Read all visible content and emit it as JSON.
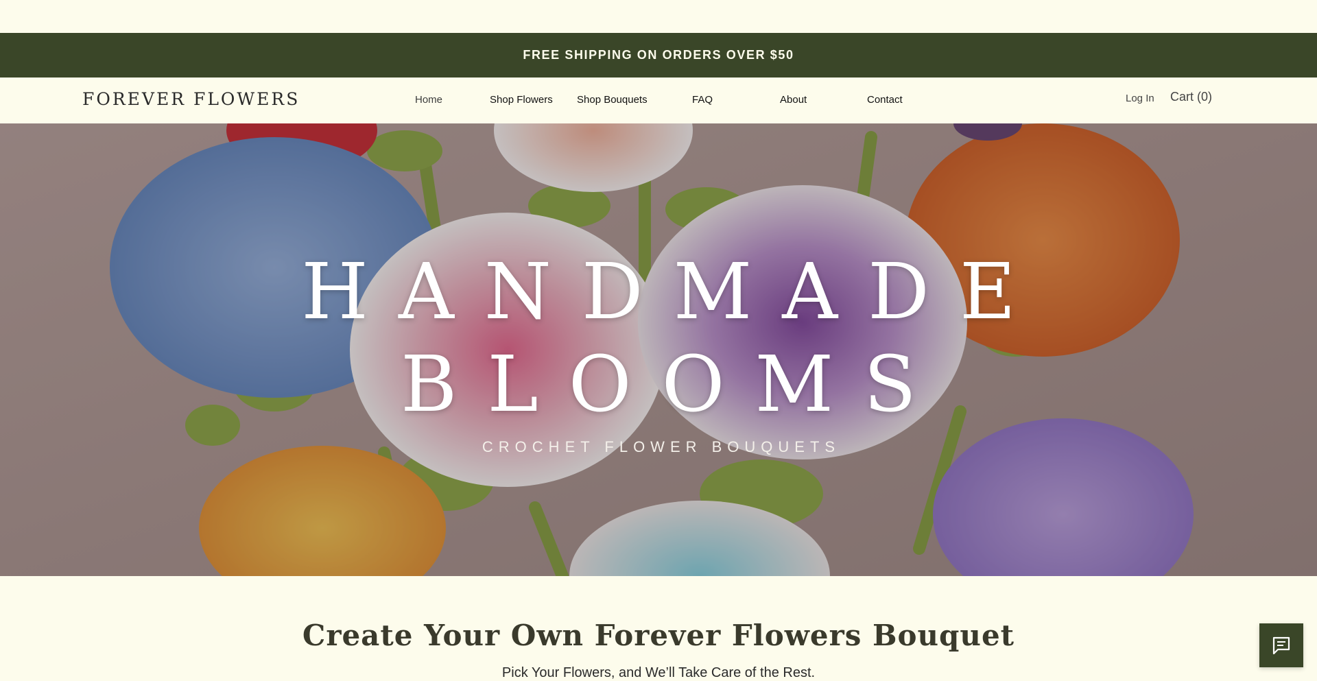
{
  "promo": {
    "text": "FREE SHIPPING ON ORDERS OVER $50"
  },
  "header": {
    "logo": "FOREVER FLOWERS",
    "nav": [
      {
        "label": "Home",
        "active": true
      },
      {
        "label": "Shop Flowers"
      },
      {
        "label": "Shop Bouquets"
      },
      {
        "label": "FAQ"
      },
      {
        "label": "About"
      },
      {
        "label": "Contact"
      }
    ],
    "login_label": "Log In",
    "cart_label": "Cart (0)"
  },
  "hero": {
    "title_line1": "HANDMADE",
    "title_line2": "BLOOMS",
    "subtitle": "CROCHET FLOWER BOUQUETS"
  },
  "section": {
    "title": "Create Your Own Forever Flowers Bouquet",
    "subtitle": "Pick Your Flowers, and We’ll Take Care of the Rest."
  },
  "chat": {
    "icon": "chat-icon"
  },
  "colors": {
    "accent": "#3a4628",
    "background": "#fdfcec"
  }
}
